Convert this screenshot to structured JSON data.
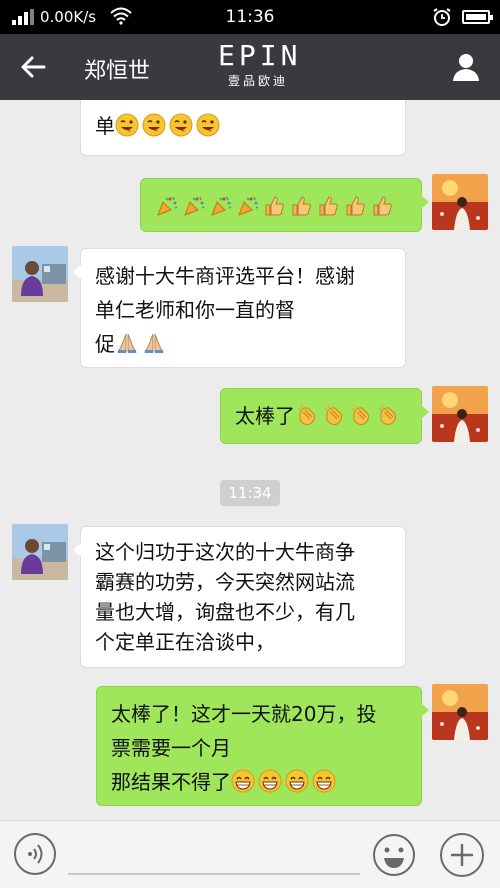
{
  "status_bar": {
    "network_speed": "0.00K/s",
    "time": "11:36"
  },
  "header": {
    "contact_name": "郑恒世",
    "brand_main": "EPIN",
    "brand_sub": "壹品欧迪"
  },
  "messages": [
    {
      "side": "in",
      "lines": [
        "单"
      ],
      "emoji": "grin-wink-emoji",
      "emoji_count": 4
    },
    {
      "side": "out",
      "text": "",
      "emojis": [
        "party-popper-emoji",
        "party-popper-emoji",
        "party-popper-emoji",
        "party-popper-emoji",
        "thumbs-up-emoji",
        "thumbs-up-emoji",
        "thumbs-up-emoji",
        "thumbs-up-emoji",
        "thumbs-up-emoji"
      ]
    },
    {
      "side": "in",
      "lines": [
        "感谢十大牛商评选平台！感谢",
        "单仁老师和你一直的督",
        "促"
      ],
      "emoji": "pray-emoji",
      "emoji_count": 2
    },
    {
      "side": "out",
      "text": "太棒了",
      "emoji": "clap-emoji",
      "emoji_count": 4
    },
    {
      "side": "in",
      "lines": [
        "这个归功于这次的十大牛商争",
        "霸赛的功劳，今天突然网站流",
        "量也大增，询盘也不少，有几",
        "个定单正在洽谈中，"
      ]
    },
    {
      "side": "out",
      "lines": [
        "太棒了！这才一天就20万，投",
        "票需要一个月",
        "那结果不得了"
      ],
      "emoji": "grin-emoji",
      "emoji_count": 4
    }
  ],
  "timestamp": "11:34",
  "input_bar": {
    "placeholder": ""
  },
  "colors": {
    "title_bar": "#393a3f",
    "sent_bubble": "#9fe65b",
    "received_bubble": "#ffffff",
    "chat_bg": "#ececec"
  }
}
